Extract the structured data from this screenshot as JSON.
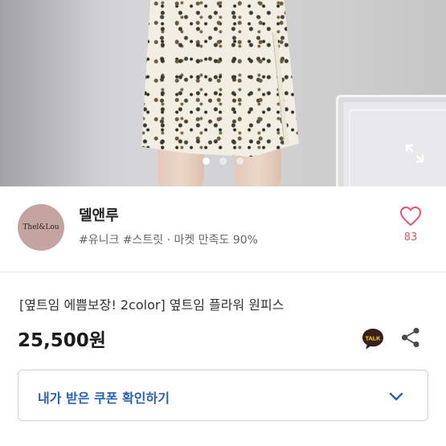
{
  "product_image": {
    "carousel_count": 3,
    "active_index": 0,
    "expand_icon": "expand-arrows-icon"
  },
  "seller": {
    "avatar_text": "Thel&Lou",
    "name": "델앤루",
    "tags": "#유니크 #스트릿 · 마켓 만족도 90%",
    "like_icon": "heart-outline-icon",
    "like_count": "83"
  },
  "product": {
    "title": "[옆트임 에쁨보장! 2color] 옆트임 플라워 원피스",
    "price": "25,500원",
    "talk_icon": "talk-bubble-icon",
    "talk_label": "TALK",
    "share_icon": "share-icon"
  },
  "coupon": {
    "label": "내가 받은 쿠폰 확인하기",
    "chevron_icon": "chevron-down-icon"
  },
  "colors": {
    "like": "#e4556b",
    "coupon_text": "#2a5fb8",
    "talk_bg": "#3a1d1d"
  }
}
